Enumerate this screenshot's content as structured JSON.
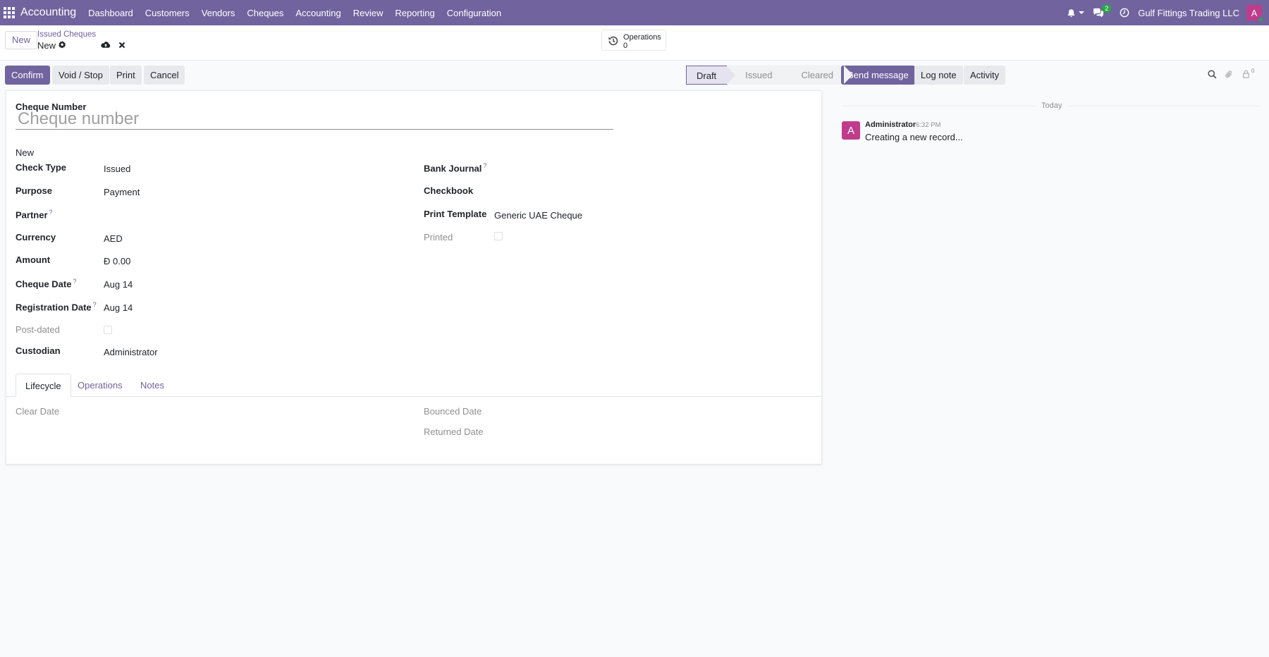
{
  "navbar": {
    "brand": "Accounting",
    "menu": [
      "Dashboard",
      "Customers",
      "Vendors",
      "Cheques",
      "Accounting",
      "Review",
      "Reporting",
      "Configuration"
    ],
    "messages_badge": "2",
    "company": "Gulf Fittings Trading LLC",
    "user_initial": "A"
  },
  "control": {
    "new_label": "New",
    "breadcrumb_parent": "Issued Cheques",
    "breadcrumb_current": "New",
    "smart_button": {
      "label": "Operations",
      "count": "0"
    }
  },
  "actions": {
    "confirm": "Confirm",
    "void_stop": "Void / Stop",
    "print": "Print",
    "cancel": "Cancel"
  },
  "statusbar": {
    "stages": [
      "Draft",
      "Issued",
      "Cleared"
    ],
    "active": "Draft"
  },
  "chatter": {
    "send_message": "Send message",
    "log_note": "Log note",
    "activity": "Activity",
    "followers_count": "0",
    "today": "Today",
    "message": {
      "author": "Administrator",
      "time": "6:32 PM",
      "body": "Creating a new record...",
      "avatar_initial": "A"
    }
  },
  "form": {
    "cheque_number_label": "Cheque Number",
    "cheque_number_placeholder": "Cheque number",
    "status_text": "New",
    "left_fields": [
      {
        "label": "Check Type",
        "value": "Issued",
        "help": false
      },
      {
        "label": "Purpose",
        "value": "Payment",
        "help": false
      },
      {
        "label": "Partner",
        "value": "",
        "help": true
      },
      {
        "label": "Currency",
        "value": "AED",
        "help": false
      },
      {
        "label": "Amount",
        "value": "Đ 0.00",
        "help": false
      },
      {
        "label": "Cheque Date",
        "value": "Aug 14",
        "help": true
      },
      {
        "label": "Registration Date",
        "value": "Aug 14",
        "help": true
      },
      {
        "label": "Post-dated",
        "value": "",
        "help": false
      },
      {
        "label": "Custodian",
        "value": "Administrator",
        "help": false
      }
    ],
    "right_fields": [
      {
        "label": "Bank Journal",
        "value": "",
        "help": true
      },
      {
        "label": "Checkbook",
        "value": "",
        "help": false
      },
      {
        "label": "Print Template",
        "value": "Generic UAE Cheque",
        "help": false
      },
      {
        "label": "Printed",
        "value": "",
        "help": false
      }
    ],
    "tabs": [
      "Lifecycle",
      "Operations",
      "Notes"
    ],
    "active_tab": "Lifecycle",
    "lifecycle": {
      "clear_date": "Clear Date",
      "bounced_date": "Bounced Date",
      "returned_date": "Returned Date"
    }
  },
  "colors": {
    "brand": "#71639e",
    "avatar": "#c03c8b",
    "badge": "#28a745"
  }
}
